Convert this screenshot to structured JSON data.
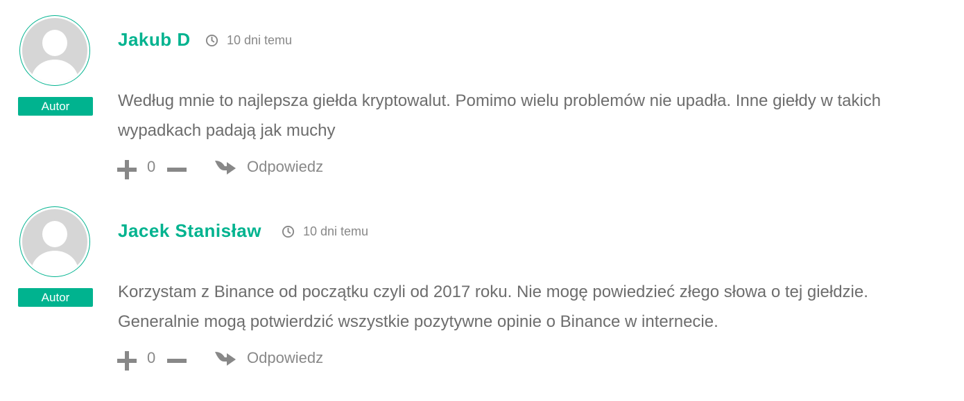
{
  "comments": [
    {
      "author": "Jakub D",
      "time": "10 dni temu",
      "badge": "Autor",
      "text": "Według mnie to najlepsza giełda kryptowalut. Pomimo wielu problemów nie upadła. Inne giełdy w takich wypadkach padają jak muchy",
      "votes": "0",
      "reply_label": "Odpowiedz"
    },
    {
      "author": "Jacek Stanisław",
      "time": "10 dni temu",
      "badge": "Autor",
      "text": "Korzystam z Binance od początku czyli od 2017 roku. Nie mogę powiedzieć złego słowa o tej giełdzie. Generalnie mogą potwierdzić wszystkie pozytywne opinie o Binance w internecie.",
      "votes": "0",
      "reply_label": "Odpowiedz"
    }
  ],
  "colors": {
    "accent": "#00b38f",
    "text": "#6d6d6d",
    "muted": "#888888"
  },
  "icons": {
    "time": "clock-icon",
    "upvote": "plus-icon",
    "downvote": "minus-icon",
    "reply": "reply-arrow-icon"
  }
}
